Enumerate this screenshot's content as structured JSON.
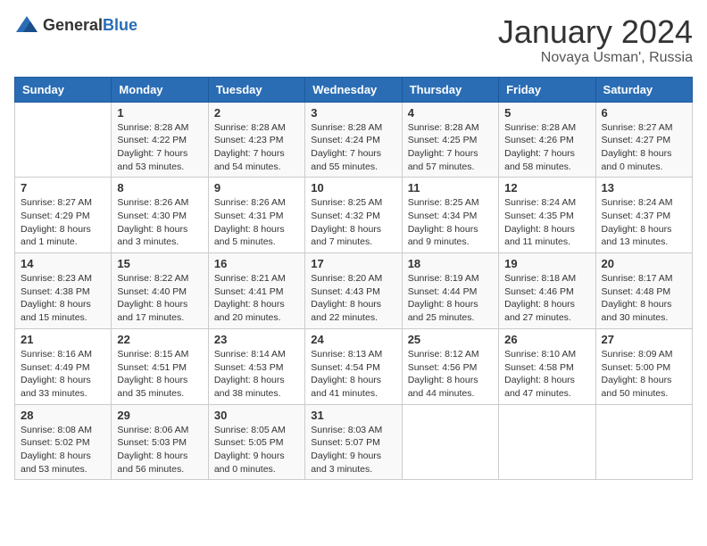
{
  "header": {
    "logo_general": "General",
    "logo_blue": "Blue",
    "title": "January 2024",
    "subtitle": "Novaya Usman', Russia"
  },
  "weekdays": [
    "Sunday",
    "Monday",
    "Tuesday",
    "Wednesday",
    "Thursday",
    "Friday",
    "Saturday"
  ],
  "weeks": [
    [
      {
        "day": "",
        "info": ""
      },
      {
        "day": "1",
        "info": "Sunrise: 8:28 AM\nSunset: 4:22 PM\nDaylight: 7 hours\nand 53 minutes."
      },
      {
        "day": "2",
        "info": "Sunrise: 8:28 AM\nSunset: 4:23 PM\nDaylight: 7 hours\nand 54 minutes."
      },
      {
        "day": "3",
        "info": "Sunrise: 8:28 AM\nSunset: 4:24 PM\nDaylight: 7 hours\nand 55 minutes."
      },
      {
        "day": "4",
        "info": "Sunrise: 8:28 AM\nSunset: 4:25 PM\nDaylight: 7 hours\nand 57 minutes."
      },
      {
        "day": "5",
        "info": "Sunrise: 8:28 AM\nSunset: 4:26 PM\nDaylight: 7 hours\nand 58 minutes."
      },
      {
        "day": "6",
        "info": "Sunrise: 8:27 AM\nSunset: 4:27 PM\nDaylight: 8 hours\nand 0 minutes."
      }
    ],
    [
      {
        "day": "7",
        "info": "Sunrise: 8:27 AM\nSunset: 4:29 PM\nDaylight: 8 hours\nand 1 minute."
      },
      {
        "day": "8",
        "info": "Sunrise: 8:26 AM\nSunset: 4:30 PM\nDaylight: 8 hours\nand 3 minutes."
      },
      {
        "day": "9",
        "info": "Sunrise: 8:26 AM\nSunset: 4:31 PM\nDaylight: 8 hours\nand 5 minutes."
      },
      {
        "day": "10",
        "info": "Sunrise: 8:25 AM\nSunset: 4:32 PM\nDaylight: 8 hours\nand 7 minutes."
      },
      {
        "day": "11",
        "info": "Sunrise: 8:25 AM\nSunset: 4:34 PM\nDaylight: 8 hours\nand 9 minutes."
      },
      {
        "day": "12",
        "info": "Sunrise: 8:24 AM\nSunset: 4:35 PM\nDaylight: 8 hours\nand 11 minutes."
      },
      {
        "day": "13",
        "info": "Sunrise: 8:24 AM\nSunset: 4:37 PM\nDaylight: 8 hours\nand 13 minutes."
      }
    ],
    [
      {
        "day": "14",
        "info": "Sunrise: 8:23 AM\nSunset: 4:38 PM\nDaylight: 8 hours\nand 15 minutes."
      },
      {
        "day": "15",
        "info": "Sunrise: 8:22 AM\nSunset: 4:40 PM\nDaylight: 8 hours\nand 17 minutes."
      },
      {
        "day": "16",
        "info": "Sunrise: 8:21 AM\nSunset: 4:41 PM\nDaylight: 8 hours\nand 20 minutes."
      },
      {
        "day": "17",
        "info": "Sunrise: 8:20 AM\nSunset: 4:43 PM\nDaylight: 8 hours\nand 22 minutes."
      },
      {
        "day": "18",
        "info": "Sunrise: 8:19 AM\nSunset: 4:44 PM\nDaylight: 8 hours\nand 25 minutes."
      },
      {
        "day": "19",
        "info": "Sunrise: 8:18 AM\nSunset: 4:46 PM\nDaylight: 8 hours\nand 27 minutes."
      },
      {
        "day": "20",
        "info": "Sunrise: 8:17 AM\nSunset: 4:48 PM\nDaylight: 8 hours\nand 30 minutes."
      }
    ],
    [
      {
        "day": "21",
        "info": "Sunrise: 8:16 AM\nSunset: 4:49 PM\nDaylight: 8 hours\nand 33 minutes."
      },
      {
        "day": "22",
        "info": "Sunrise: 8:15 AM\nSunset: 4:51 PM\nDaylight: 8 hours\nand 35 minutes."
      },
      {
        "day": "23",
        "info": "Sunrise: 8:14 AM\nSunset: 4:53 PM\nDaylight: 8 hours\nand 38 minutes."
      },
      {
        "day": "24",
        "info": "Sunrise: 8:13 AM\nSunset: 4:54 PM\nDaylight: 8 hours\nand 41 minutes."
      },
      {
        "day": "25",
        "info": "Sunrise: 8:12 AM\nSunset: 4:56 PM\nDaylight: 8 hours\nand 44 minutes."
      },
      {
        "day": "26",
        "info": "Sunrise: 8:10 AM\nSunset: 4:58 PM\nDaylight: 8 hours\nand 47 minutes."
      },
      {
        "day": "27",
        "info": "Sunrise: 8:09 AM\nSunset: 5:00 PM\nDaylight: 8 hours\nand 50 minutes."
      }
    ],
    [
      {
        "day": "28",
        "info": "Sunrise: 8:08 AM\nSunset: 5:02 PM\nDaylight: 8 hours\nand 53 minutes."
      },
      {
        "day": "29",
        "info": "Sunrise: 8:06 AM\nSunset: 5:03 PM\nDaylight: 8 hours\nand 56 minutes."
      },
      {
        "day": "30",
        "info": "Sunrise: 8:05 AM\nSunset: 5:05 PM\nDaylight: 9 hours\nand 0 minutes."
      },
      {
        "day": "31",
        "info": "Sunrise: 8:03 AM\nSunset: 5:07 PM\nDaylight: 9 hours\nand 3 minutes."
      },
      {
        "day": "",
        "info": ""
      },
      {
        "day": "",
        "info": ""
      },
      {
        "day": "",
        "info": ""
      }
    ]
  ]
}
